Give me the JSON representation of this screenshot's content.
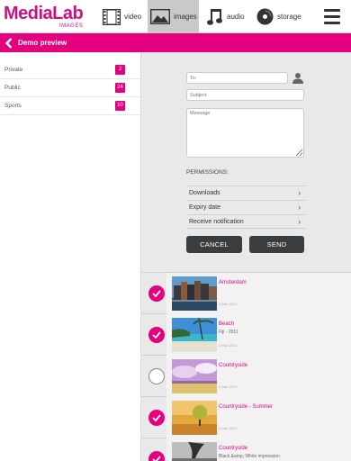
{
  "app": {
    "logo": "MediaLab",
    "logo_sub": "IMAGES"
  },
  "nav": {
    "tabs": [
      {
        "label": "video",
        "icon": "film-icon"
      },
      {
        "label": "images",
        "icon": "image-icon",
        "active": true
      },
      {
        "label": "audio",
        "icon": "music-note-icon"
      },
      {
        "label": "storage",
        "icon": "disc-icon"
      }
    ]
  },
  "header": {
    "title": "Demo preview"
  },
  "sidebar": {
    "items": [
      {
        "label": "Private",
        "count": "2"
      },
      {
        "label": "Public",
        "count": "24"
      },
      {
        "label": "Sports",
        "count": "10"
      }
    ]
  },
  "form": {
    "to_placeholder": "To:",
    "subject_placeholder": "Subject",
    "message_placeholder": "Message",
    "permissions_title": "PERMISSIONS:",
    "permissions": [
      {
        "label": "Downloads"
      },
      {
        "label": "Expiry date"
      },
      {
        "label": "Receive notification"
      }
    ],
    "cancel_label": "CANCEL",
    "send_label": "SEND"
  },
  "media": [
    {
      "title": "Amsterdam",
      "subtitle": "",
      "date": "4 Mar 2014",
      "checked": true
    },
    {
      "title": "Beach",
      "subtitle": "Fiji - 2011",
      "date": "4 Mar 2014",
      "checked": true
    },
    {
      "title": "Countryside",
      "subtitle": "",
      "date": "4 Mar 2014",
      "checked": false
    },
    {
      "title": "Countryside - Summer",
      "subtitle": "",
      "date": "4 Mar 2014",
      "checked": true
    },
    {
      "title": "Countryside",
      "subtitle": "Black &amp; White impression",
      "date": "",
      "checked": true
    }
  ],
  "colors": {
    "accent": "#e5007d",
    "button_dark": "#3a3d40",
    "panel_bg": "#e9e9e9"
  }
}
